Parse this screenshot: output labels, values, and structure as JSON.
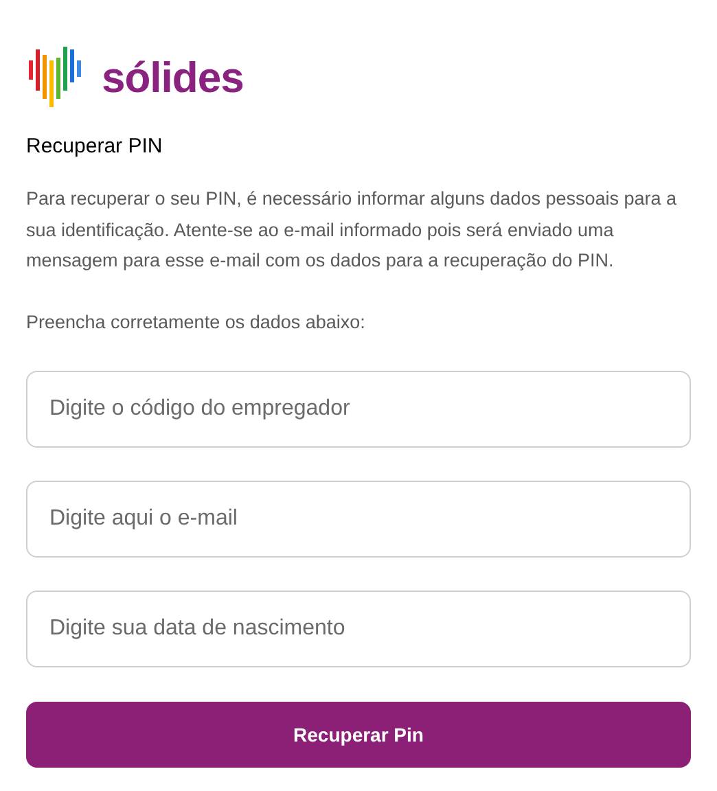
{
  "logo": {
    "text": "sólides"
  },
  "title": "Recuperar PIN",
  "description": "Para recuperar o seu PIN, é necessário informar alguns dados pessoais para a sua identificação. Atente-se ao e-mail informado pois será enviado uma mensagem para esse e-mail com os dados para a recuperação do PIN.",
  "instruction": "Preencha corretamente os dados abaixo:",
  "fields": [
    {
      "placeholder": "Digite o código do empregador"
    },
    {
      "placeholder": "Digite aqui o e-mail"
    },
    {
      "placeholder": "Digite sua data de nascimento"
    }
  ],
  "submit_button": "Recuperar Pin"
}
